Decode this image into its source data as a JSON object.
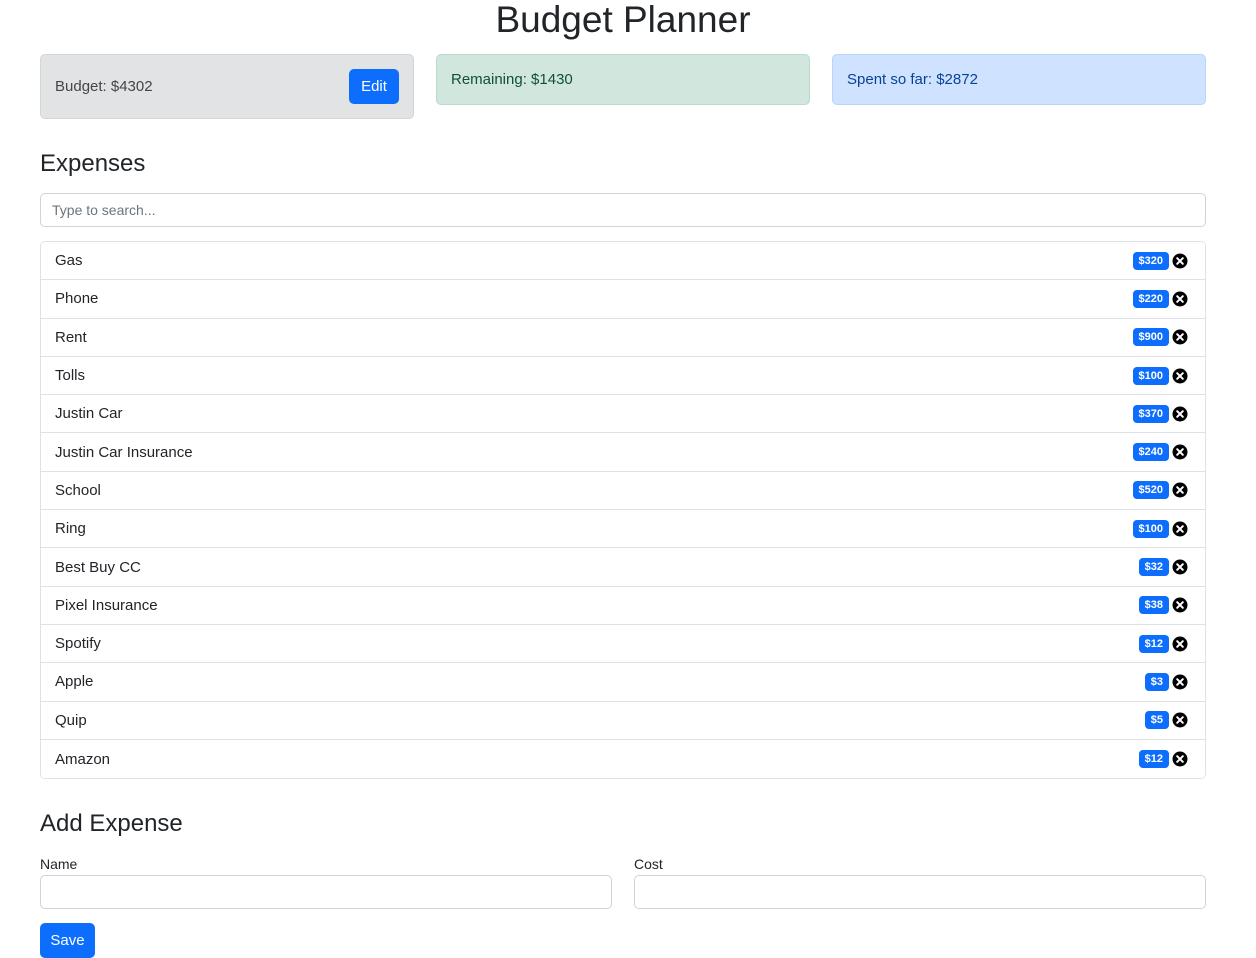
{
  "app": {
    "title": "Budget Planner"
  },
  "summary": {
    "budget_text": "Budget: $4302",
    "edit_label": "Edit",
    "remaining_text": "Remaining: $1430",
    "spent_text": "Spent so far: $2872"
  },
  "expenses": {
    "heading": "Expenses",
    "search_placeholder": "Type to search...",
    "items": [
      {
        "name": "Gas",
        "cost": "$320"
      },
      {
        "name": "Phone",
        "cost": "$220"
      },
      {
        "name": "Rent",
        "cost": "$900"
      },
      {
        "name": "Tolls",
        "cost": "$100"
      },
      {
        "name": "Justin Car",
        "cost": "$370"
      },
      {
        "name": "Justin Car Insurance",
        "cost": "$240"
      },
      {
        "name": "School",
        "cost": "$520"
      },
      {
        "name": "Ring",
        "cost": "$100"
      },
      {
        "name": "Best Buy CC",
        "cost": "$32"
      },
      {
        "name": "Pixel Insurance",
        "cost": "$38"
      },
      {
        "name": "Spotify",
        "cost": "$12"
      },
      {
        "name": "Apple",
        "cost": "$3"
      },
      {
        "name": "Quip",
        "cost": "$5"
      },
      {
        "name": "Amazon",
        "cost": "$12"
      }
    ],
    "delete_icon": "close-circle-icon"
  },
  "add_expense": {
    "heading": "Add Expense",
    "name_label": "Name",
    "name_value": "",
    "cost_label": "Cost",
    "cost_value": "",
    "save_label": "Save"
  },
  "colors": {
    "primary": "#0d6efd",
    "budget_bg": "#e2e3e5",
    "remaining_bg": "#d1e7dd",
    "spent_bg": "#cfe2ff"
  }
}
